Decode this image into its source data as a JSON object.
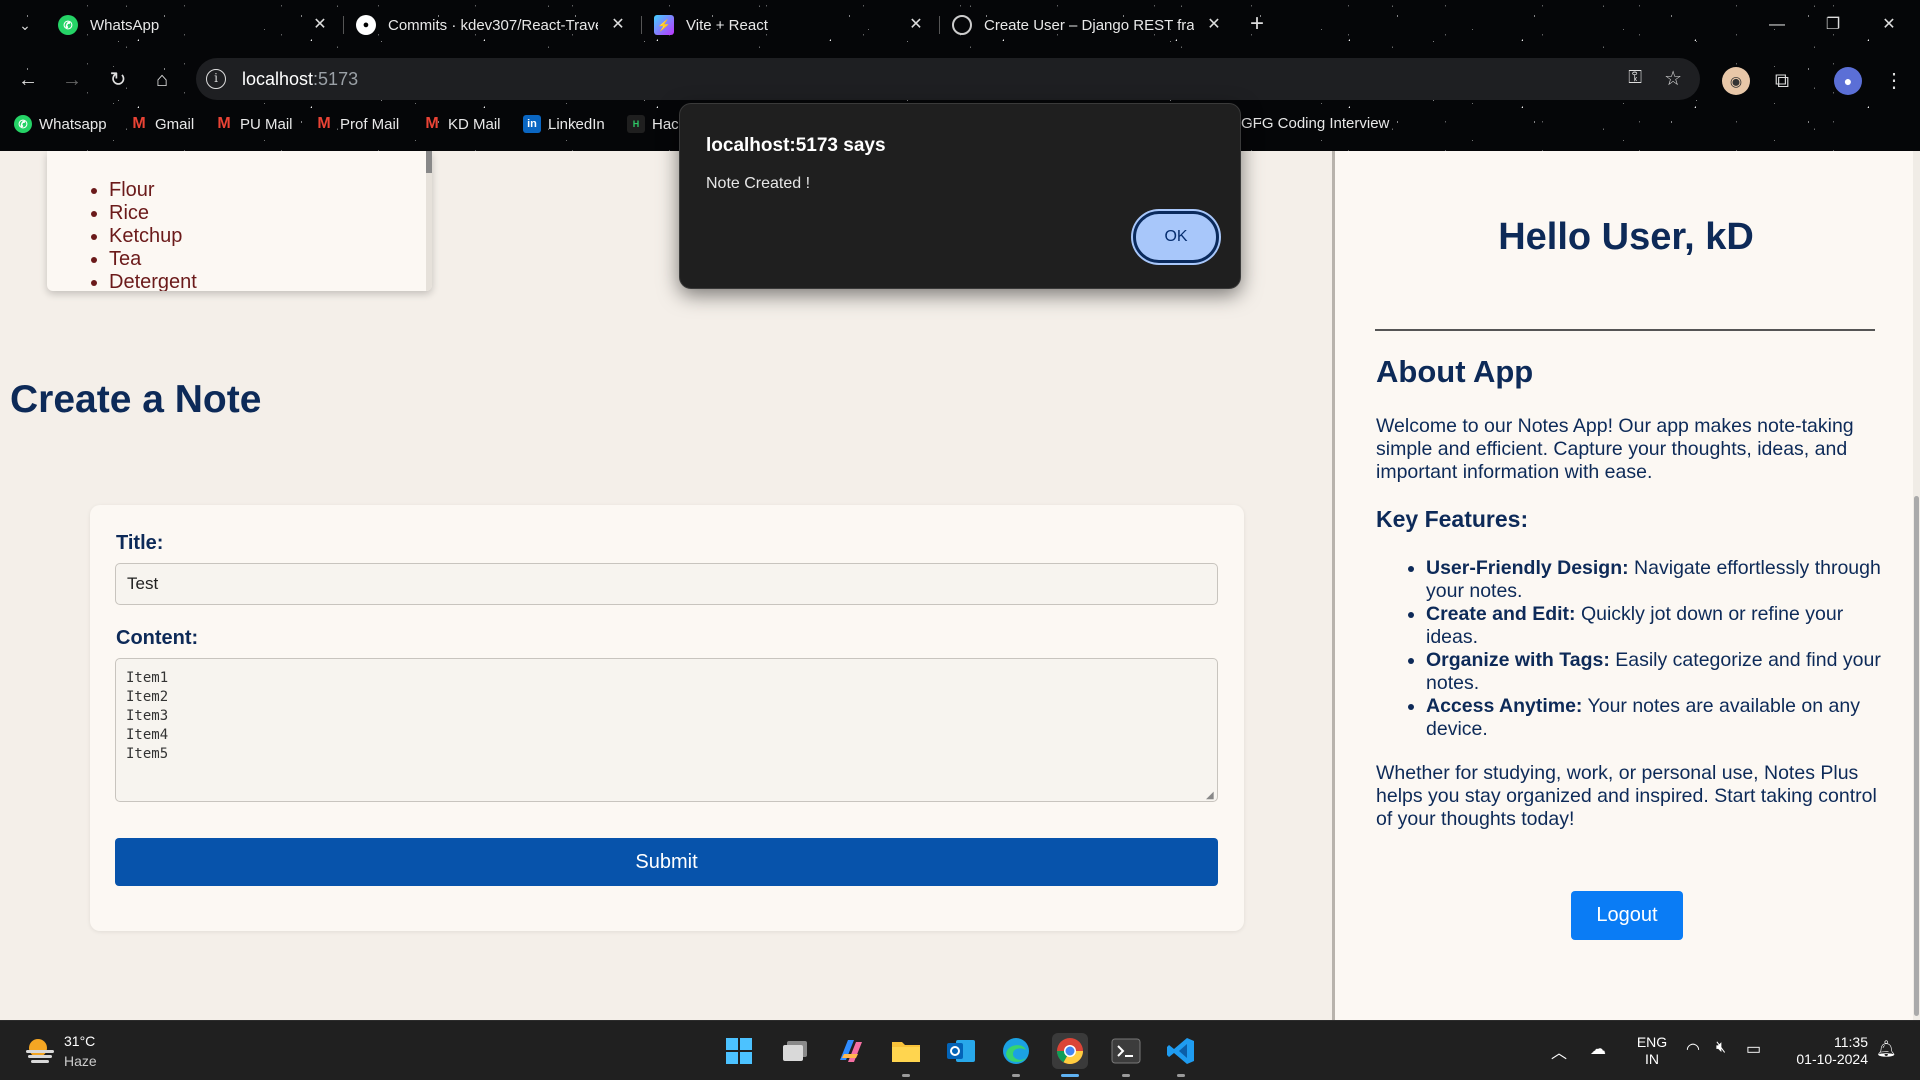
{
  "browser": {
    "tabs": [
      {
        "label": "WhatsApp",
        "icon": "whatsapp-icon"
      },
      {
        "label": "Commits · kdev307/React-Trave",
        "icon": "github-icon"
      },
      {
        "label": "Vite + React",
        "icon": "vite-icon"
      },
      {
        "label": "Create User – Django REST fram",
        "icon": "globe-icon"
      }
    ],
    "url_host": "localhost",
    "url_port": ":5173",
    "bookmarks": [
      {
        "label": "Whatsapp",
        "icon": "whatsapp-icon"
      },
      {
        "label": "Gmail",
        "icon": "gmail-icon"
      },
      {
        "label": "PU Mail",
        "icon": "gmail-icon"
      },
      {
        "label": "Prof Mail",
        "icon": "gmail-icon"
      },
      {
        "label": "KD Mail",
        "icon": "gmail-icon"
      },
      {
        "label": "LinkedIn",
        "icon": "linkedin-icon"
      },
      {
        "label": "Hac",
        "icon": "hackerrank-icon"
      },
      {
        "label": "GFG Coding Interview",
        "icon": ""
      }
    ]
  },
  "note_preview": {
    "items": [
      "Flour",
      "Rice",
      "Ketchup",
      "Tea",
      "Detergent"
    ]
  },
  "create": {
    "heading": "Create a Note",
    "title_label": "Title:",
    "title_value": "Test",
    "content_label": "Content:",
    "content_value": "Item1\nItem2\nItem3\nItem4\nItem5",
    "submit_label": "Submit"
  },
  "sidebar": {
    "greeting": "Hello User, kD",
    "about_heading": "About App",
    "about_text": "Welcome to our Notes App! Our app makes note-taking simple and efficient. Capture your thoughts, ideas, and important information with ease.",
    "features_heading": "Key Features:",
    "features": [
      {
        "name": "User-Friendly Design:",
        "text": " Navigate effortlessly through your notes."
      },
      {
        "name": "Create and Edit:",
        "text": " Quickly jot down or refine your ideas."
      },
      {
        "name": "Organize with Tags:",
        "text": " Easily categorize and find your notes."
      },
      {
        "name": "Access Anytime:",
        "text": " Your notes are available on any device."
      }
    ],
    "closing_text": "Whether for studying, work, or personal use, Notes Plus helps you stay organized and inspired. Start taking control of your thoughts today!",
    "logout_label": "Logout"
  },
  "alert": {
    "title": "localhost:5173 says",
    "message": "Note Created !",
    "ok_label": "OK"
  },
  "taskbar": {
    "temperature": "31°C",
    "weather": "Haze",
    "lang_line1": "ENG",
    "lang_line2": "IN",
    "time": "11:35",
    "date": "01-10-2024"
  },
  "colors": {
    "heading": "#0d2a58",
    "submit": "#0753ab",
    "logout": "#0a7cf5",
    "note_text": "#6b1a1a"
  }
}
